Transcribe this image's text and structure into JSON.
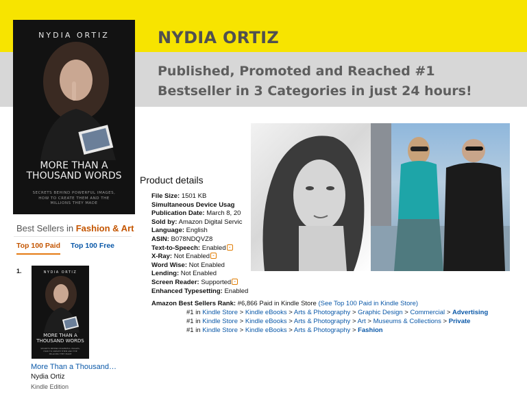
{
  "header": {
    "name": "NYDIA ORTIZ",
    "tagline_line1": "Published, Promoted and Reached #1",
    "tagline_line2": "Bestseller in 3 Categories in just 24 hours!"
  },
  "book_cover": {
    "author": "NYDIA ORTIZ",
    "title_line1": "MORE THAN A",
    "title_line2": "THOUSAND WORDS",
    "tagline_line1": "SECRETS BEHIND POWERFUL IMAGES,",
    "tagline_line2": "HOW TO CREATE THEM AND THE",
    "tagline_line3": "MILLIONS THEY MADE"
  },
  "product_details": {
    "heading": "Product details",
    "rows": [
      {
        "label": "File Size:",
        "value": "1501 KB"
      },
      {
        "label": "Simultaneous Device Usag",
        "value": ""
      },
      {
        "label": "Publication Date:",
        "value": "March 8, 20"
      },
      {
        "label": "Sold by:",
        "value": "Amazon Digital Servic"
      },
      {
        "label": "Language:",
        "value": "English"
      },
      {
        "label": "ASIN:",
        "value": "B078NDQVZ8"
      },
      {
        "label": "Text-to-Speech:",
        "value": "Enabled"
      },
      {
        "label": "X-Ray:",
        "value": "Not Enabled"
      },
      {
        "label": "Word Wise:",
        "value": "Not Enabled"
      },
      {
        "label": "Lending:",
        "value": "Not Enabled"
      },
      {
        "label": "Screen Reader:",
        "value": "Supported"
      },
      {
        "label": "Enhanced Typesetting:",
        "value": "Enabled"
      }
    ],
    "rank_label": "Amazon Best Sellers Rank:",
    "rank_value": "#6,866 Paid in Kindle Store",
    "rank_link": "(See Top 100 Paid in Kindle Store)",
    "sep": ">",
    "category_ranks": [
      {
        "num": "#1 in",
        "path": [
          "Kindle Store",
          "Kindle eBooks",
          "Arts & Photography",
          "Graphic Design",
          "Commercial"
        ],
        "leaf": "Advertising"
      },
      {
        "num": "#1 in",
        "path": [
          "Kindle Store",
          "Kindle eBooks",
          "Arts & Photography",
          "Art",
          "Museums & Collections"
        ],
        "leaf": "Private"
      },
      {
        "num": "#1 in",
        "path": [
          "Kindle Store",
          "Kindle eBooks",
          "Arts & Photography"
        ],
        "leaf": "Fashion"
      }
    ]
  },
  "best_sellers": {
    "title_prefix": "Best Sellers in",
    "category": "Fashion & Art",
    "tab_paid": "Top 100 Paid",
    "tab_free": "Top 100 Free",
    "rank": "1.",
    "book_title": "More Than a Thousand…",
    "book_author": "Nydia Ortiz",
    "book_format": "Kindle Edition"
  },
  "colors": {
    "yellow": "#f7e400",
    "grey_band": "#d7d7d7",
    "amazon_link": "#0a58a8",
    "amazon_orange": "#c45500"
  }
}
